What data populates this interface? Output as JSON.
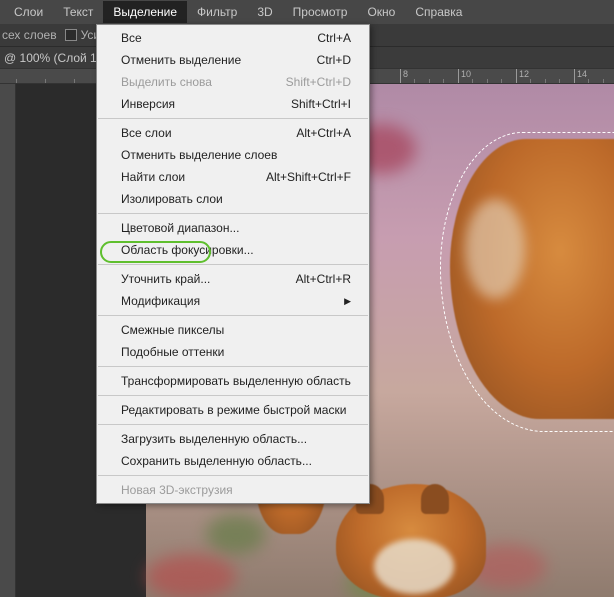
{
  "menubar": {
    "items": [
      {
        "label": "Слои"
      },
      {
        "label": "Текст"
      },
      {
        "label": "Выделение",
        "active": true
      },
      {
        "label": "Фильтр"
      },
      {
        "label": "3D"
      },
      {
        "label": "Просмотр"
      },
      {
        "label": "Окно"
      },
      {
        "label": "Справка"
      }
    ]
  },
  "options_bar": {
    "layers_fragment": "сех слоев",
    "checkbox_label": "Уси"
  },
  "tab": {
    "title": "@ 100% (Слой 1"
  },
  "ruler": {
    "ticks": [
      "8",
      "10",
      "12",
      "14"
    ]
  },
  "dropdown": {
    "groups": [
      [
        {
          "label": "Все",
          "shortcut": "Ctrl+A"
        },
        {
          "label": "Отменить выделение",
          "shortcut": "Ctrl+D"
        },
        {
          "label": "Выделить снова",
          "shortcut": "Shift+Ctrl+D",
          "disabled": true
        },
        {
          "label": "Инверсия",
          "shortcut": "Shift+Ctrl+I"
        }
      ],
      [
        {
          "label": "Все слои",
          "shortcut": "Alt+Ctrl+A"
        },
        {
          "label": "Отменить выделение слоев",
          "shortcut": ""
        },
        {
          "label": "Найти слои",
          "shortcut": "Alt+Shift+Ctrl+F"
        },
        {
          "label": "Изолировать слои",
          "shortcut": ""
        }
      ],
      [
        {
          "label": "Цветовой диапазон...",
          "shortcut": ""
        },
        {
          "label": "Область фокусировки...",
          "shortcut": ""
        }
      ],
      [
        {
          "label": "Уточнить край...",
          "shortcut": "Alt+Ctrl+R",
          "highlighted": true
        },
        {
          "label": "Модификация",
          "shortcut": "",
          "submenu": true
        }
      ],
      [
        {
          "label": "Смежные пикселы",
          "shortcut": ""
        },
        {
          "label": "Подобные оттенки",
          "shortcut": ""
        }
      ],
      [
        {
          "label": "Трансформировать выделенную область",
          "shortcut": ""
        }
      ],
      [
        {
          "label": "Редактировать в режиме быстрой маски",
          "shortcut": ""
        }
      ],
      [
        {
          "label": "Загрузить выделенную область...",
          "shortcut": ""
        },
        {
          "label": "Сохранить выделенную область...",
          "shortcut": ""
        }
      ],
      [
        {
          "label": "Новая 3D-экструзия",
          "shortcut": "",
          "disabled": true
        }
      ]
    ]
  }
}
